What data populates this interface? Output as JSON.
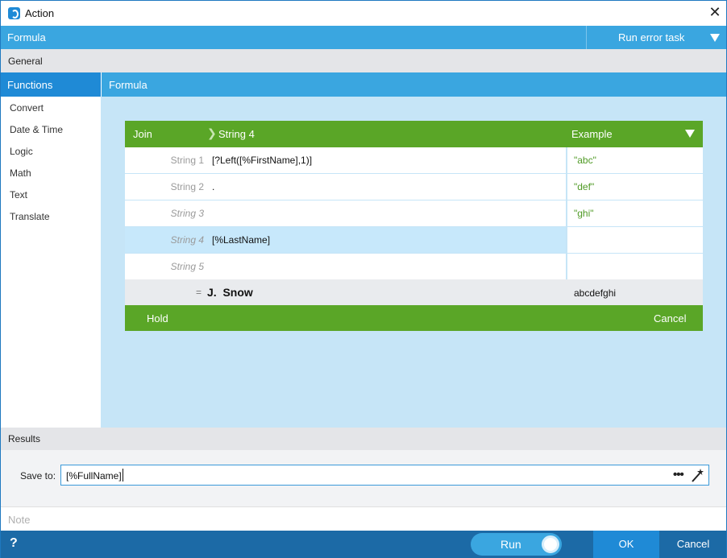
{
  "window": {
    "title": "Action",
    "close_glyph": "✕"
  },
  "formula_bar": {
    "label": "Formula",
    "run_error_task": "Run error task"
  },
  "tabs": {
    "general": "General"
  },
  "functions": {
    "header": "Functions",
    "items": [
      "Convert",
      "Date & Time",
      "Logic",
      "Math",
      "Text",
      "Translate"
    ]
  },
  "formula_panel": {
    "header": "Formula"
  },
  "join": {
    "label": "Join",
    "breadcrumb": "String 4",
    "example_header": "Example",
    "rows": [
      {
        "label": "String 1",
        "value": "[?Left([%FirstName],1)]",
        "example": "\"abc\""
      },
      {
        "label": "String 2",
        "value": ".",
        "example": "\"def\""
      },
      {
        "label": "String 3",
        "value": "",
        "example": "\"ghi\""
      },
      {
        "label": "String 4",
        "value": "[%LastName]",
        "example": ""
      },
      {
        "label": "String 5",
        "value": "",
        "example": ""
      }
    ],
    "result_eq": "=",
    "result": "J.  Snow",
    "example_result": "abcdefghi",
    "hold": "Hold",
    "cancel": "Cancel"
  },
  "results": {
    "header": "Results",
    "save_to_label": "Save to:",
    "save_to_value": "[%FullName]",
    "more_glyph": "•••"
  },
  "note": {
    "placeholder": "Note"
  },
  "footer": {
    "help": "?",
    "run": "Run",
    "ok": "OK",
    "cancel": "Cancel"
  },
  "colors": {
    "accent_blue": "#3aa6e0",
    "dark_blue": "#1c6aa6",
    "green": "#5aa627",
    "workspace": "#c6e5f7"
  }
}
